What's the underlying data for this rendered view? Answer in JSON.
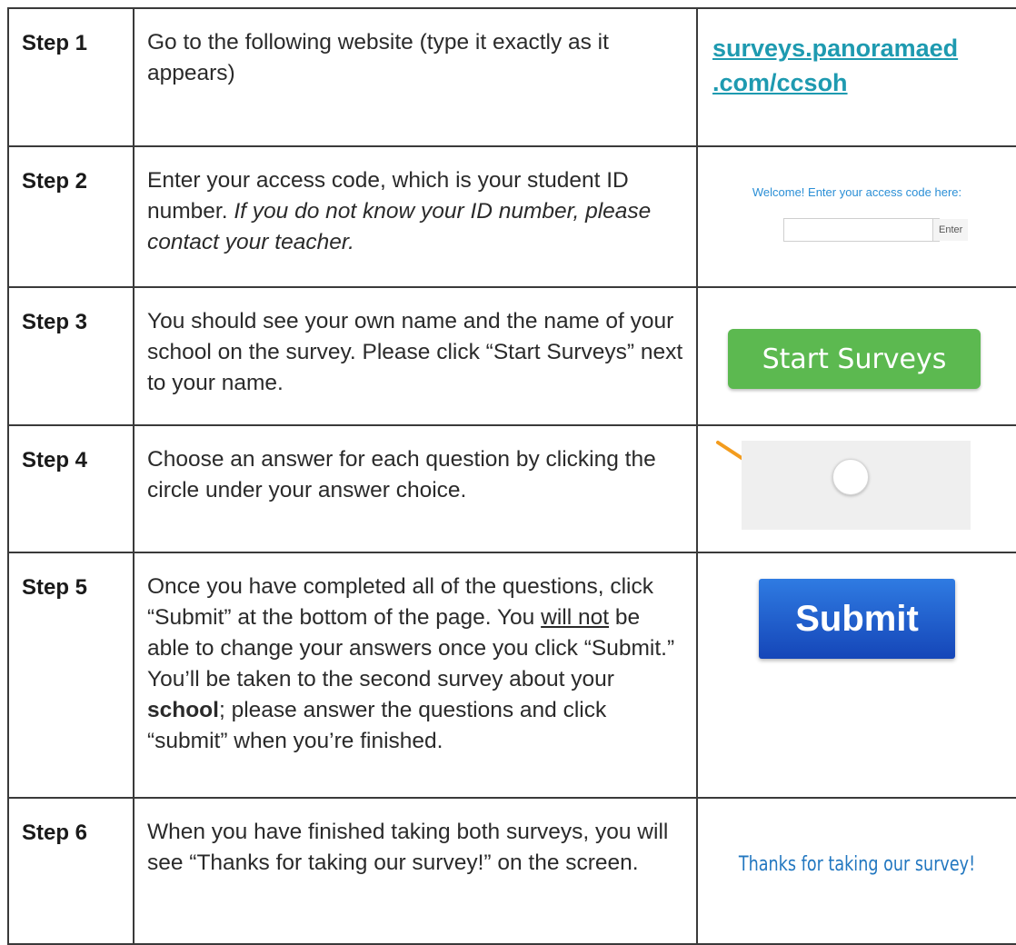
{
  "steps": [
    {
      "label": "Step 1",
      "text": "Go to the following website (type it exactly as it appears)",
      "link": "surveys.panoramaed .com/ccsoh"
    },
    {
      "label": "Step 2",
      "text_plain": "Enter your access code, which is your student ID number. ",
      "text_italic": "If you do not know your ID number, please contact your teacher.",
      "welcome": "Welcome! Enter your access code here:",
      "input_value": "",
      "enter_label": "Enter"
    },
    {
      "label": "Step 3",
      "text": "You should see your own name and the name of your school on the survey. Please click “Start Surveys” next to your name.",
      "button": "Start Surveys"
    },
    {
      "label": "Step 4",
      "text": "Choose an answer for each question by clicking the circle under your answer choice."
    },
    {
      "label": "Step 5",
      "text_a": "Once you have completed all of the questions, click “Submit” at the bottom of the page. You ",
      "text_underline": "will not",
      "text_b": " be able to change your answers once you click “Submit.” You’ll be taken to the second survey about your ",
      "text_bold": "school",
      "text_c": "; please answer the questions and click “submit” when you’re finished.",
      "button": "Submit"
    },
    {
      "label": "Step 6",
      "text": "When you have finished taking both surveys, you will see “Thanks for taking our survey!” on the screen.",
      "thanks": "Thanks for taking our survey!"
    }
  ],
  "colors": {
    "link": "#1e9ab0",
    "start_button": "#5cb950",
    "submit_button": "#1f5fd0",
    "arrow": "#f39c1e"
  },
  "icons": {
    "step4_arrow": "arrow-icon",
    "step4_radio": "radio-circle-icon"
  }
}
